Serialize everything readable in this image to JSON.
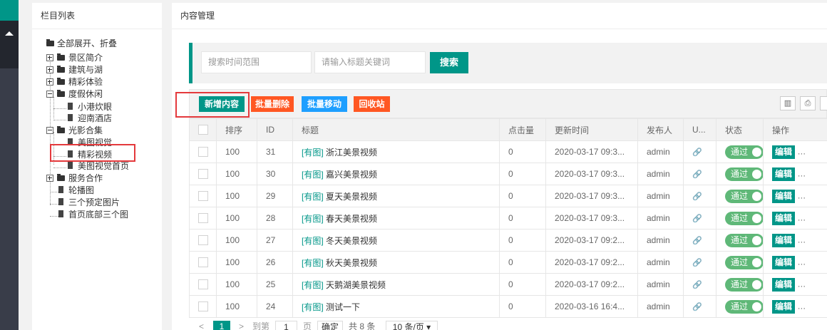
{
  "tree_panel": {
    "title": "栏目列表",
    "root_label": "全部展开、折叠",
    "nodes": [
      {
        "label": "景区简介"
      },
      {
        "label": "建筑与湖"
      },
      {
        "label": "精彩体验"
      },
      {
        "label": "度假休闲"
      },
      {
        "label": "小港炊眼"
      },
      {
        "label": "迎南酒店"
      },
      {
        "label": "光影合集"
      },
      {
        "label": "美图视觉"
      },
      {
        "label": "精彩视频"
      },
      {
        "label": "美图视觉首页"
      },
      {
        "label": "服务合作"
      },
      {
        "label": "轮播图"
      },
      {
        "label": "三个预定图片"
      },
      {
        "label": "首页底部三个图"
      }
    ]
  },
  "main": {
    "title": "内容管理",
    "search": {
      "date_placeholder": "搜索时间范围",
      "keyword_placeholder": "请输入标题关键词",
      "button": "搜索"
    },
    "toolbar": {
      "add": "新增内容",
      "batch_delete": "批量删除",
      "batch_move": "批量移动",
      "recycle": "回收站"
    },
    "columns": [
      "排序",
      "ID",
      "标题",
      "点击量",
      "更新时间",
      "发布人",
      "U...",
      "状态",
      "操作"
    ],
    "rows": [
      {
        "sort": "100",
        "id": "31",
        "tag": "[有图]",
        "title": "浙江美景视频",
        "clicks": "0",
        "updated": "2020-03-17 09:3...",
        "publisher": "admin",
        "status": "通过",
        "action": "编辑"
      },
      {
        "sort": "100",
        "id": "30",
        "tag": "[有图]",
        "title": "嘉兴美景视频",
        "clicks": "0",
        "updated": "2020-03-17 09:3...",
        "publisher": "admin",
        "status": "通过",
        "action": "编辑"
      },
      {
        "sort": "100",
        "id": "29",
        "tag": "[有图]",
        "title": "夏天美景视频",
        "clicks": "0",
        "updated": "2020-03-17 09:3...",
        "publisher": "admin",
        "status": "通过",
        "action": "编辑"
      },
      {
        "sort": "100",
        "id": "28",
        "tag": "[有图]",
        "title": "春天美景视频",
        "clicks": "0",
        "updated": "2020-03-17 09:3...",
        "publisher": "admin",
        "status": "通过",
        "action": "编辑"
      },
      {
        "sort": "100",
        "id": "27",
        "tag": "[有图]",
        "title": "冬天美景视频",
        "clicks": "0",
        "updated": "2020-03-17 09:2...",
        "publisher": "admin",
        "status": "通过",
        "action": "编辑"
      },
      {
        "sort": "100",
        "id": "26",
        "tag": "[有图]",
        "title": "秋天美景视频",
        "clicks": "0",
        "updated": "2020-03-17 09:2...",
        "publisher": "admin",
        "status": "通过",
        "action": "编辑"
      },
      {
        "sort": "100",
        "id": "25",
        "tag": "[有图]",
        "title": "天鹅湖美景视频",
        "clicks": "0",
        "updated": "2020-03-17 09:2...",
        "publisher": "admin",
        "status": "通过",
        "action": "编辑"
      },
      {
        "sort": "100",
        "id": "24",
        "tag": "[有图]",
        "title": "测试一下",
        "clicks": "0",
        "updated": "2020-03-16 16:4...",
        "publisher": "admin",
        "status": "通过",
        "action": "编辑"
      }
    ],
    "pager": {
      "prev": "<",
      "current": "1",
      "next": ">",
      "goto_label": "到第",
      "goto_value": "1",
      "page_unit": "页",
      "confirm": "确定",
      "total": "共 8 条",
      "page_size": "10 条/页"
    }
  },
  "colors": {
    "primary": "#009688",
    "danger": "#ff5722",
    "info": "#1e9fff",
    "highlight": "#e4393c",
    "switch_on": "#5fb878"
  }
}
